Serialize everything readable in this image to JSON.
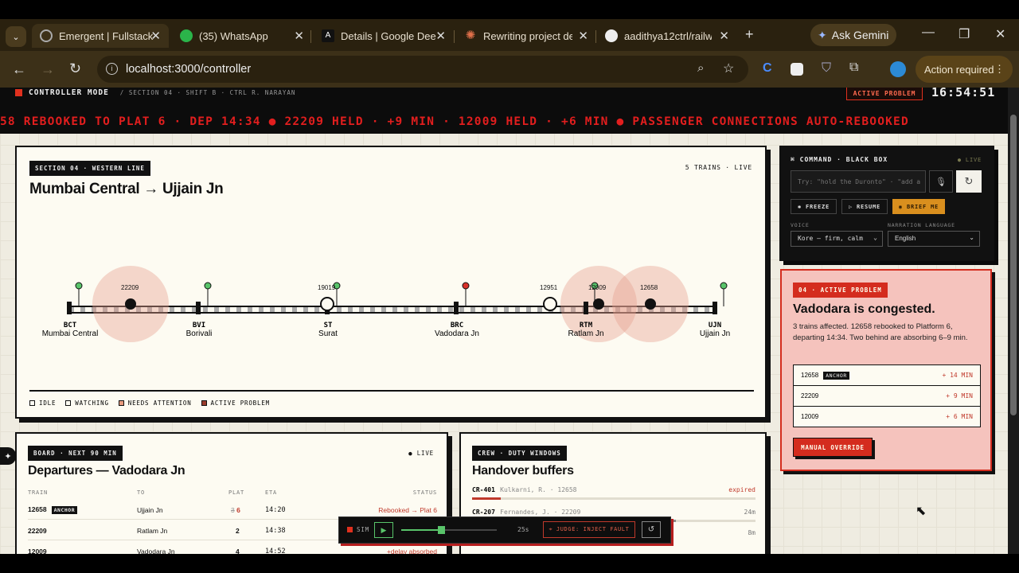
{
  "browser": {
    "tabs": [
      {
        "title": "Emergent | Fullstack",
        "icon": "globe-icon",
        "active": true
      },
      {
        "title": "(35) WhatsApp",
        "icon": "whatsapp-icon"
      },
      {
        "title": "Details | Google Dee",
        "icon": "ai-studio-icon"
      },
      {
        "title": "Rewriting project de",
        "icon": "claude-icon"
      },
      {
        "title": "aadithya12ctrl/railw",
        "icon": "github-icon"
      }
    ],
    "ask_gemini": "Ask Gemini",
    "url": "localhost:3000/controller",
    "action_required": "Action required"
  },
  "header": {
    "mode": "CONTROLLER MODE",
    "meta": "/ SECTION 04 · SHIFT B · CTRL R. NARAYAN",
    "badge": "ACTIVE PROBLEM",
    "clock": "16:54:51",
    "ticker": "58 REBOOKED TO PLAT 6 · DEP 14:34 ● 22209 HELD · +9 MIN · 12009 HELD · +6 MIN ● PASSENGER CONNECTIONS AUTO-REBOOKED"
  },
  "map": {
    "tag": "SECTION 04 · WESTERN LINE",
    "title": "Mumbai Central → Ujjain Jn",
    "count": "5 TRAINS · LIVE",
    "stations": [
      {
        "code": "BCT",
        "name": "Mumbai Central"
      },
      {
        "code": "BVI",
        "name": "Borivali"
      },
      {
        "code": "ST",
        "name": "Surat"
      },
      {
        "code": "BRC",
        "name": "Vadodara Jn"
      },
      {
        "code": "RTM",
        "name": "Ratlam Jn"
      },
      {
        "code": "UJN",
        "name": "Ujjain Jn"
      }
    ],
    "trains": [
      "22209",
      "19019",
      "12951",
      "12009",
      "12658"
    ],
    "legend": [
      "IDLE",
      "WATCHING",
      "NEEDS ATTENTION",
      "ACTIVE PROBLEM"
    ],
    "colors": {
      "idle": "#fdfbf2",
      "watching": "#fdfbf2",
      "attention": "#e79a7d",
      "active": "#9a3a2a",
      "signal_green": "#59c46a",
      "signal_red": "#d8312a"
    }
  },
  "board": {
    "tag": "BOARD · NEXT 90 MIN",
    "live": "● LIVE",
    "title": "Departures — Vadodara Jn",
    "cols": [
      "TRAIN",
      "TO",
      "PLAT",
      "ETA",
      "STATUS"
    ],
    "rows": [
      {
        "train": "12658",
        "anchor": "ANCHOR",
        "to": "Ujjain Jn",
        "plat_old": "3",
        "plat": "6",
        "eta": "14:20",
        "status": "Rebooked → Plat 6"
      },
      {
        "train": "22209",
        "to": "Ratlam Jn",
        "plat": "2",
        "eta": "14:38",
        "status": ""
      },
      {
        "train": "12009",
        "to": "Vadodara Jn",
        "plat": "4",
        "eta": "14:52",
        "status": "+delay absorbed"
      }
    ]
  },
  "crew": {
    "tag": "CREW · DUTY WINDOWS",
    "title": "Handover buffers",
    "rows": [
      {
        "id": "CR-401",
        "name": "Kulkarni, R. · 12658",
        "value": "expired",
        "fill": 0.1
      },
      {
        "id": "CR-207",
        "name": "Fernandes, J. · 22209",
        "value": "24m",
        "fill": 0.72
      },
      {
        "id": "",
        "name": "",
        "value": "8m",
        "fill": 0.2
      }
    ]
  },
  "command": {
    "title": "COMMAND · BLACK BOX",
    "live": "● LIVE",
    "placeholder": "Try: \"hold the Duronto\" · \"add a",
    "freeze": "✱ FREEZE",
    "resume": "▷ RESUME",
    "brief": "◉ BRIEF ME",
    "voice_label": "VOICE",
    "voice": "Kore — firm, calm",
    "lang_label": "NARRATION LANGUAGE",
    "lang": "English"
  },
  "problem": {
    "tag": "04 · ACTIVE PROBLEM",
    "title": "Vadodara is congested.",
    "desc": "3 trains affected. 12658 rebooked to Platform 6, departing 14:34. Two behind are absorbing 6–9 min.",
    "rows": [
      {
        "train": "12658",
        "anchor": "ANCHOR",
        "delay": "+ 14 MIN"
      },
      {
        "train": "22209",
        "delay": "+ 9 MIN"
      },
      {
        "train": "12009",
        "delay": "+ 6 MIN"
      }
    ],
    "override": "MANUAL OVERRIDE"
  },
  "sim": {
    "label": "SIM",
    "speed": "25s",
    "inject": "⌖ JUDGE: INJECT FAULT",
    "slider": 0.42
  }
}
